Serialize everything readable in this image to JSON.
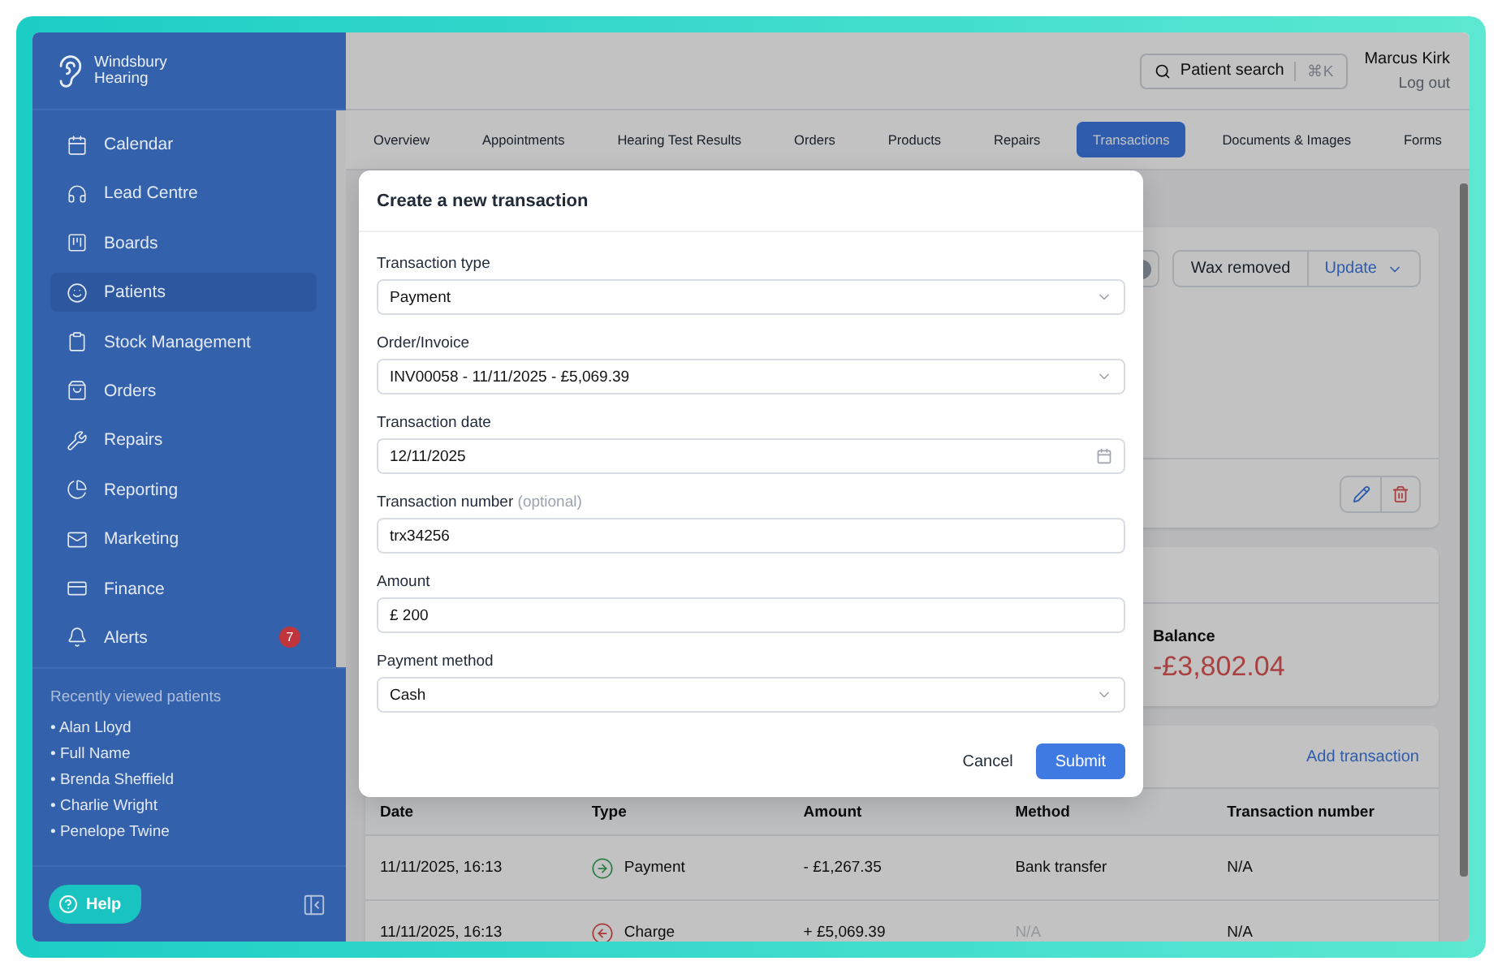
{
  "brand": {
    "name": "Windsbury Hearing"
  },
  "nav": [
    {
      "label": "Calendar",
      "selected": false
    },
    {
      "label": "Lead Centre",
      "selected": false
    },
    {
      "label": "Boards",
      "selected": false
    },
    {
      "label": "Patients",
      "selected": true
    },
    {
      "label": "Stock Management",
      "selected": false
    },
    {
      "label": "Orders",
      "selected": false
    },
    {
      "label": "Repairs",
      "selected": false
    },
    {
      "label": "Reporting",
      "selected": false
    },
    {
      "label": "Marketing",
      "selected": false
    },
    {
      "label": "Finance",
      "selected": false
    },
    {
      "label": "Alerts",
      "selected": false,
      "badge": "7"
    }
  ],
  "recent": {
    "title": "Recently viewed patients",
    "patients": [
      "• Alan Lloyd",
      "• Full Name",
      "• Brenda Sheffield",
      "• Charlie Wright",
      "• Penelope Twine"
    ]
  },
  "help_button": "Help",
  "topbar": {
    "search": {
      "label": "Patient search",
      "shortcut": "⌘K"
    },
    "user": {
      "name": "Marcus Kirk",
      "action": "Log out"
    }
  },
  "tabs": [
    {
      "label": "Overview",
      "selected": false
    },
    {
      "label": "Appointments",
      "selected": false
    },
    {
      "label": "Hearing Test Results",
      "selected": false
    },
    {
      "label": "Orders",
      "selected": false
    },
    {
      "label": "Products",
      "selected": false
    },
    {
      "label": "Repairs",
      "selected": false
    },
    {
      "label": "Transactions",
      "selected": true
    },
    {
      "label": "Documents & Images",
      "selected": false
    },
    {
      "label": "Forms",
      "selected": false
    }
  ],
  "status_card": {
    "chip": "Wax removed",
    "update": "Update"
  },
  "balance": {
    "label": "Balance",
    "value": "-£3,802.04"
  },
  "transactions": {
    "add_label": "Add transaction",
    "columns": [
      "Date",
      "Type",
      "Amount",
      "Method",
      "Transaction number"
    ],
    "rows": [
      {
        "date": "11/11/2025, 16:13",
        "kind": "payment",
        "type": "Payment",
        "amount": "- £1,267.35",
        "method": "Bank transfer",
        "method_muted": false,
        "number": "N/A"
      },
      {
        "date": "11/11/2025, 16:13",
        "kind": "charge",
        "type": "Charge",
        "amount": "+ £5,069.39",
        "method": "N/A",
        "method_muted": true,
        "number": "N/A"
      }
    ]
  },
  "modal": {
    "title": "Create a new transaction",
    "fields": [
      {
        "label": "Transaction type",
        "kind": "select",
        "value": "Payment"
      },
      {
        "label": "Order/Invoice",
        "kind": "select",
        "value": "INV00058 - 11/11/2025 - £5,069.39"
      },
      {
        "label": "Transaction date",
        "kind": "date",
        "value": "12/11/2025"
      },
      {
        "label": "Transaction number",
        "hint": "(optional)",
        "kind": "text",
        "value": "trx34256"
      },
      {
        "label": "Amount",
        "kind": "text",
        "value": "£ 200"
      },
      {
        "label": "Payment method",
        "kind": "select",
        "value": "Cash"
      }
    ],
    "cancel": "Cancel",
    "submit": "Submit"
  }
}
